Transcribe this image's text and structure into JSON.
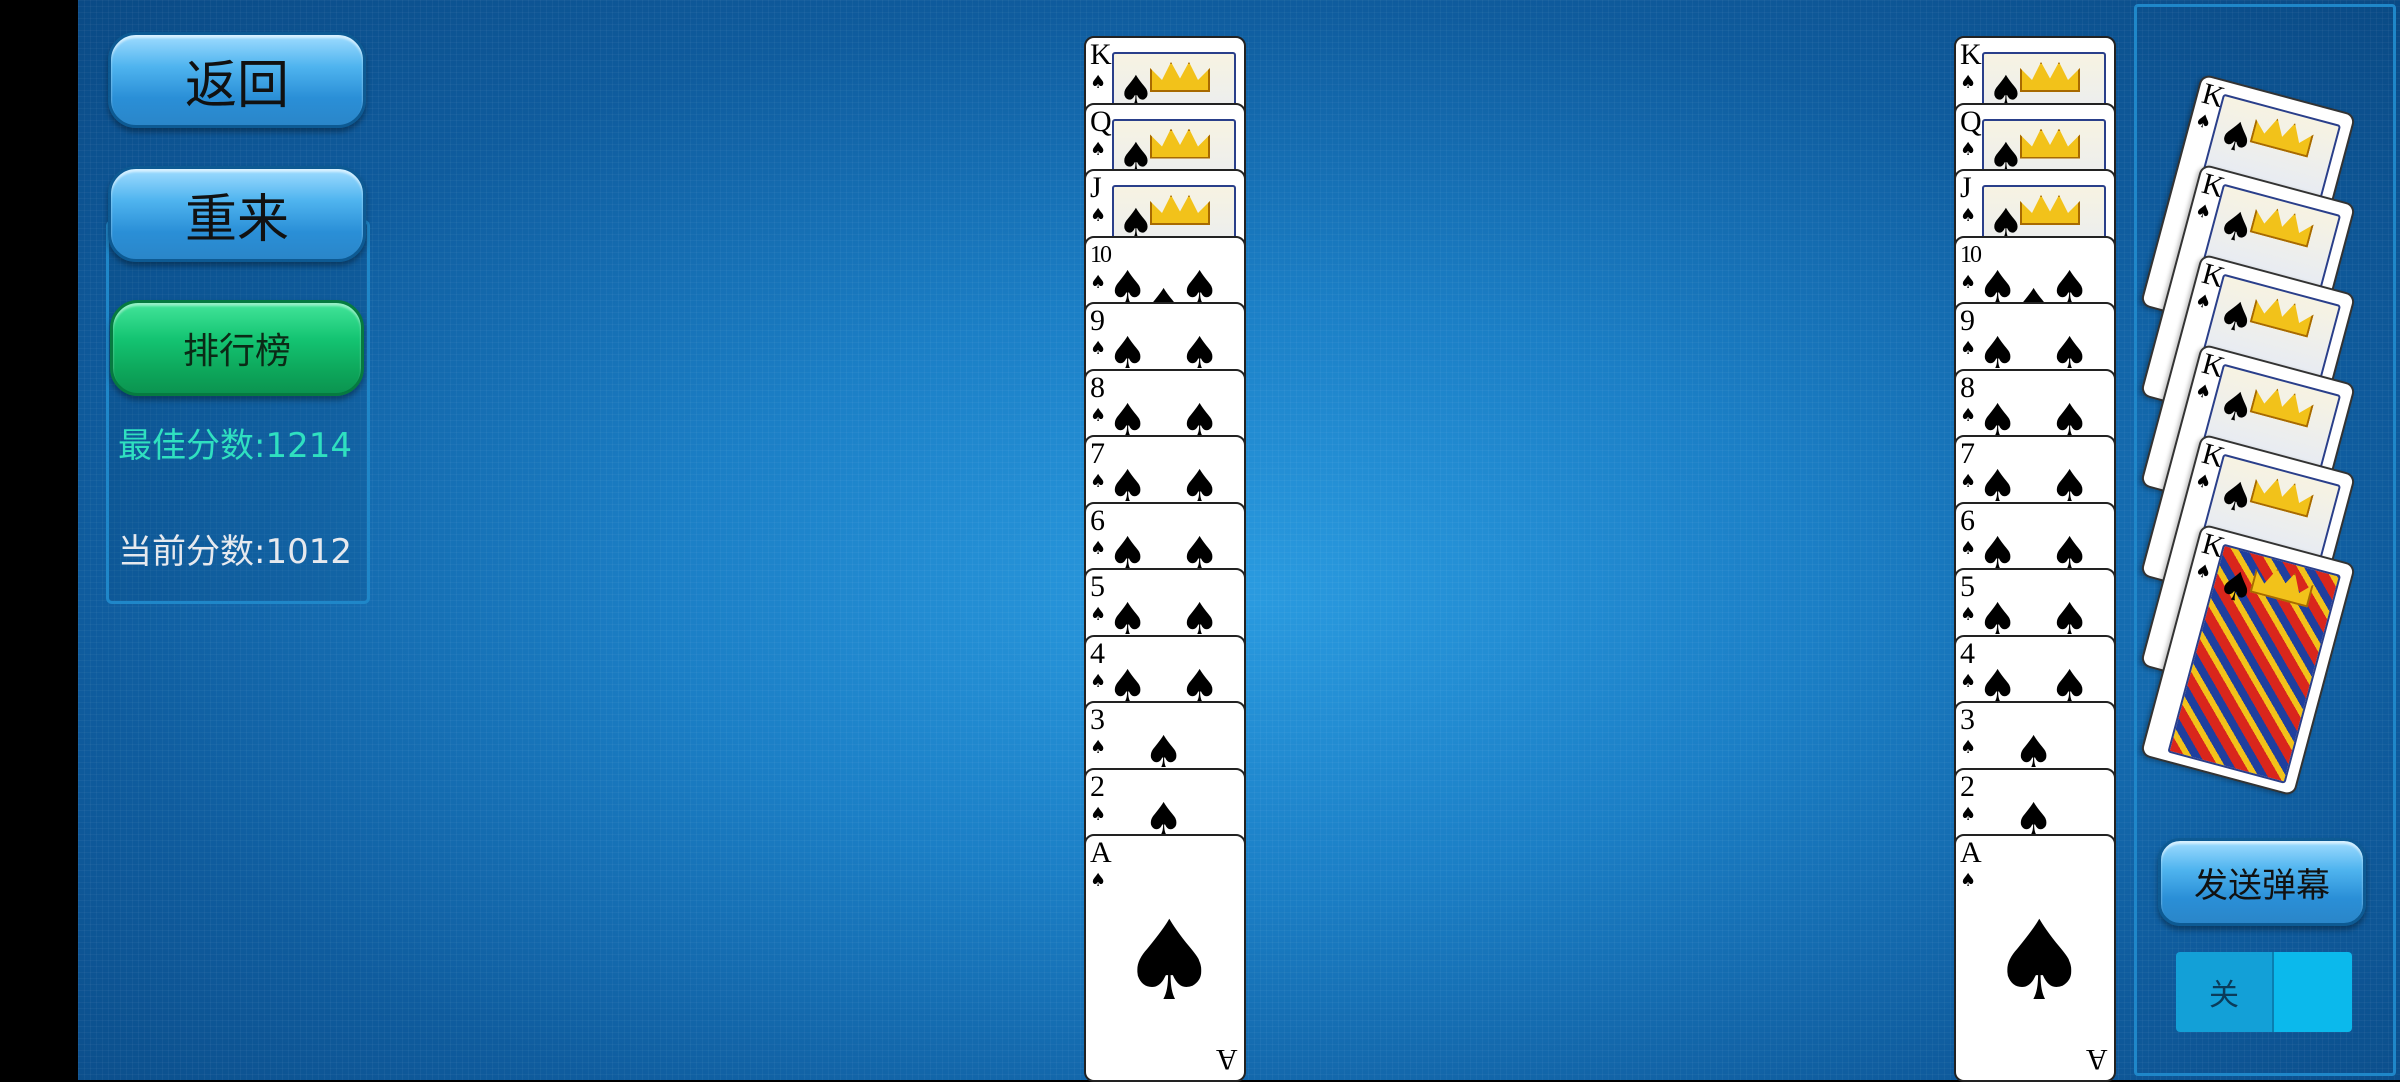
{
  "buttons": {
    "back": "返回",
    "restart": "重来",
    "leaderboard": "排行榜",
    "send_danmu": "发送弹幕"
  },
  "scores": {
    "best": "最佳分数:1214",
    "current": "当前分数:1012"
  },
  "toggle": {
    "label": "关",
    "state": "off"
  },
  "suit_symbol": "♠",
  "columns": [
    {
      "ranks": [
        "K",
        "Q",
        "J",
        "10",
        "9",
        "8",
        "7",
        "6",
        "5",
        "4",
        "3",
        "2",
        "A"
      ]
    },
    {
      "ranks": [
        "K",
        "Q",
        "J",
        "10",
        "9",
        "8",
        "7",
        "6",
        "5",
        "4",
        "3",
        "2",
        "A"
      ]
    }
  ],
  "completed_fan": {
    "count": 6,
    "rank": "K"
  },
  "colors": {
    "board": "#1b7fc6",
    "accent_green": "#14c472",
    "best_score": "#2fe0c0"
  }
}
